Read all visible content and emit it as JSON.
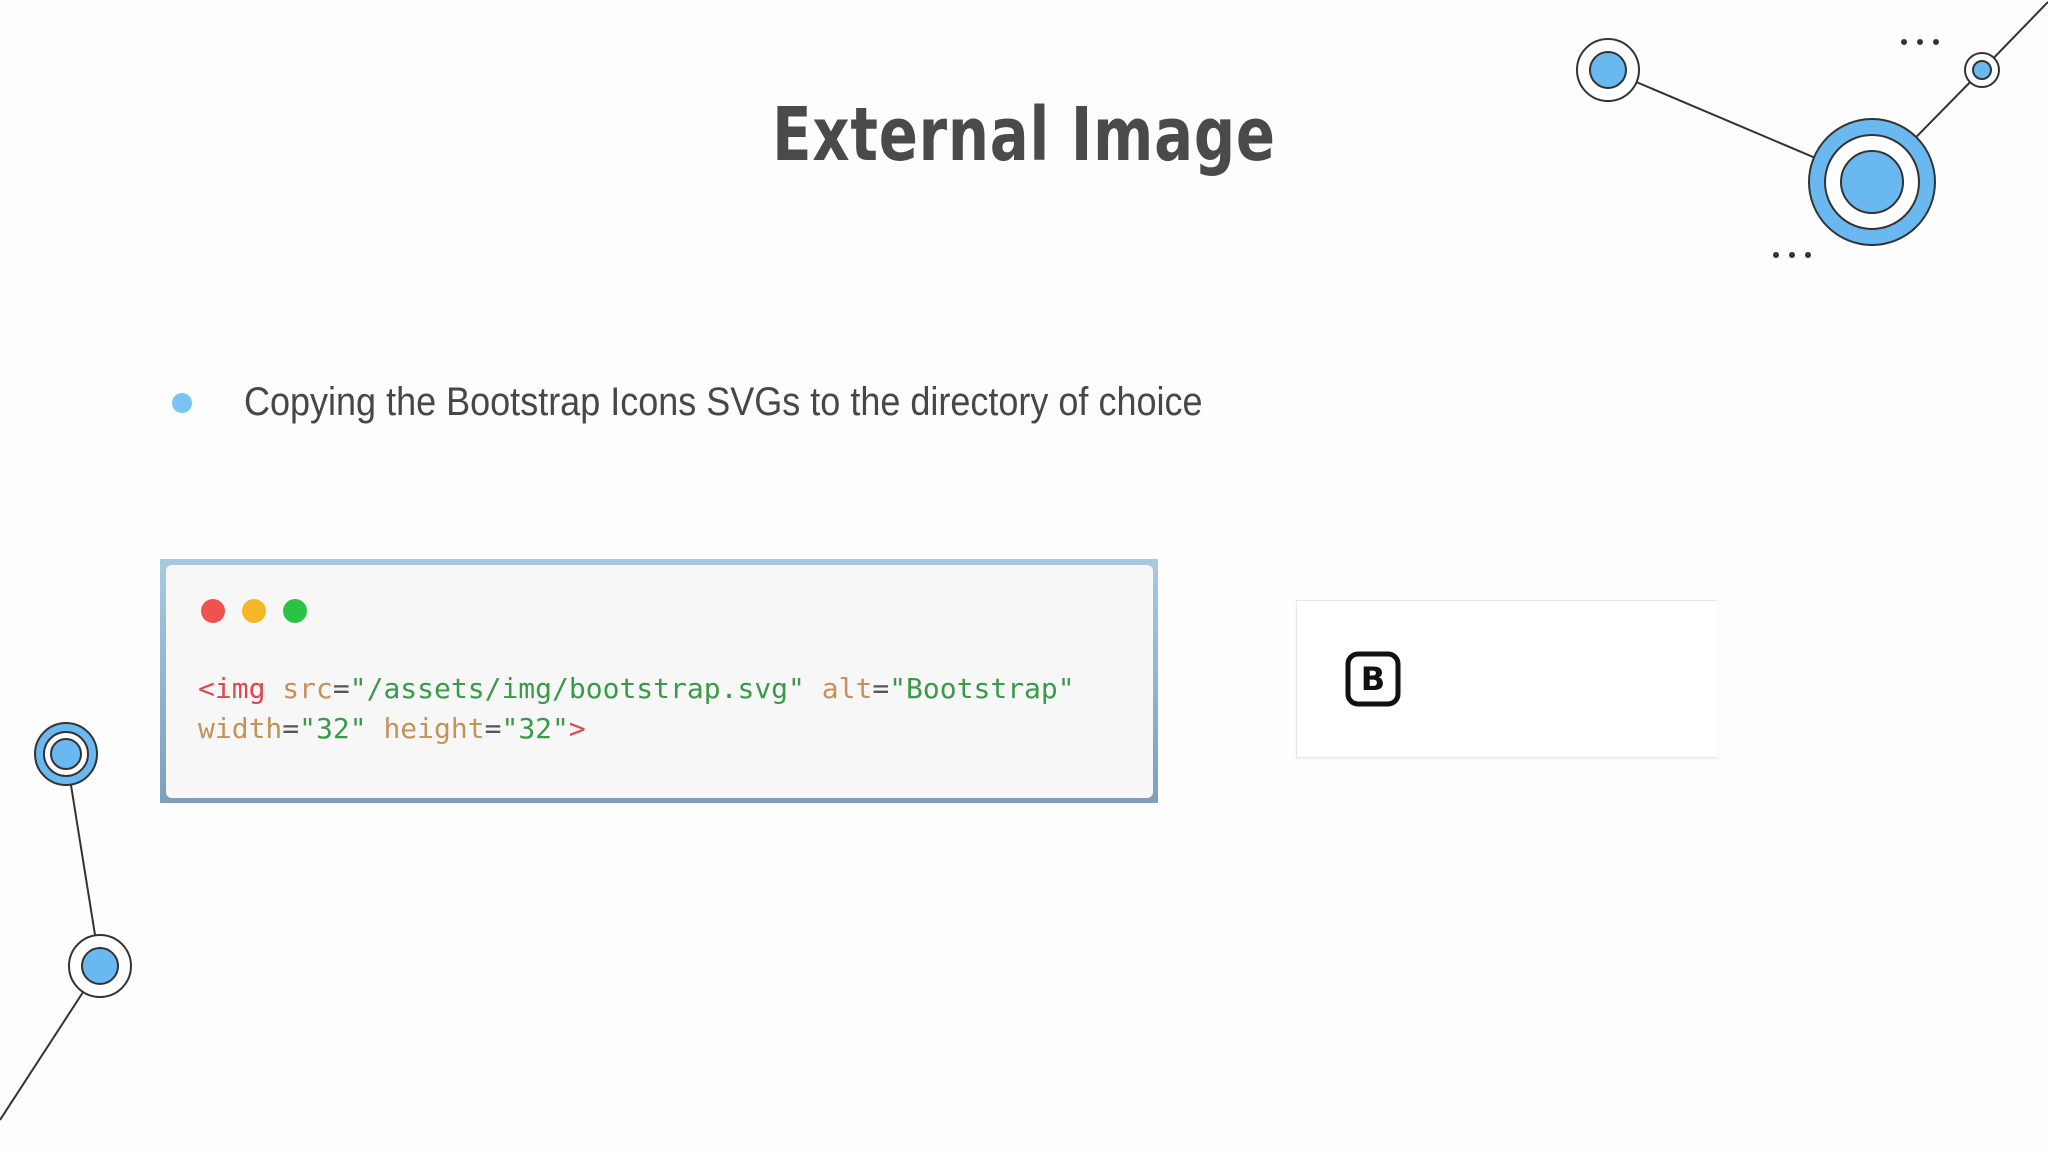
{
  "slide": {
    "title": "External Image",
    "bullets": [
      "Copying the Bootstrap Icons SVGs to the directory of choice"
    ]
  },
  "code_window": {
    "buttons": [
      "close-dot",
      "minimize-dot",
      "maximize-dot"
    ],
    "lines": [
      {
        "tag_open": "<img",
        "attr1": "src",
        "eq1": "=",
        "val1": "\"/assets/img/bootstrap.svg\"",
        "attr2": "alt",
        "eq2": "=",
        "val2": "\"Bootstrap\""
      },
      {
        "attr3": "width",
        "eq3": "=",
        "val3": "\"32\"",
        "attr4": "height",
        "eq4": "=",
        "val4": "\"32\"",
        "tag_close": ">"
      }
    ]
  },
  "preview": {
    "icon": "bootstrap-logo-icon",
    "icon_letter": "B"
  },
  "colors": {
    "accent_blue": "#6ab8f0",
    "title": "#4a4a4a",
    "tag": "#e0484f",
    "attribute": "#c5925a",
    "string": "#3b9a4a"
  }
}
